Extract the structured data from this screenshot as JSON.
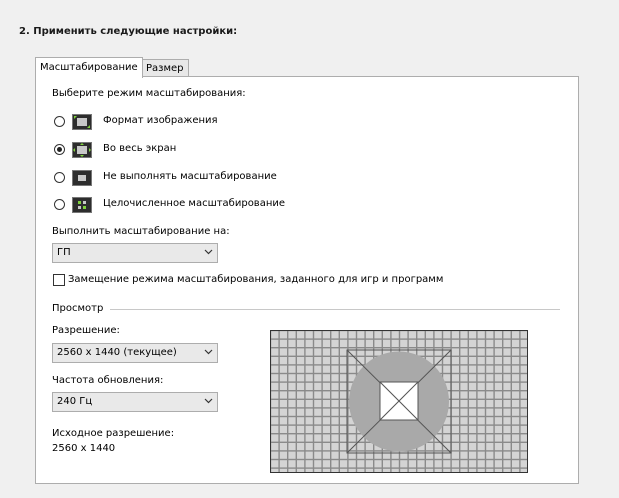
{
  "section": {
    "title": "2. Применить следующие настройки:"
  },
  "tabs": [
    {
      "label": "Масштабирование",
      "active": true
    },
    {
      "label": "Размер",
      "active": false
    }
  ],
  "scaling": {
    "prompt": "Выберите режим масштабирования:",
    "modes": [
      {
        "label": "Формат изображения",
        "icon": "aspect-ratio-icon",
        "selected": false
      },
      {
        "label": "Во весь экран",
        "icon": "full-screen-icon",
        "selected": true
      },
      {
        "label": "Не выполнять масштабирование",
        "icon": "no-scaling-icon",
        "selected": false
      },
      {
        "label": "Целочисленное масштабирование",
        "icon": "integer-scaling-icon",
        "selected": false
      }
    ],
    "perform_on_label": "Выполнить масштабирование на:",
    "perform_on_value": "ГП",
    "override_label": "Замещение режима масштабирования, заданного для игр и программ",
    "override_checked": false
  },
  "preview": {
    "title": "Просмотр",
    "resolution_label": "Разрешение:",
    "resolution_value": "2560 x 1440 (текущее)",
    "refresh_label": "Частота обновления:",
    "refresh_value": "240 Гц",
    "native_label": "Исходное разрешение:",
    "native_value": "2560 x 1440"
  },
  "colors": {
    "panel_bg": "#ffffff",
    "page_bg": "#f0f0f0",
    "grid": "#8a8a8a",
    "shape": "#a8a8a8"
  }
}
